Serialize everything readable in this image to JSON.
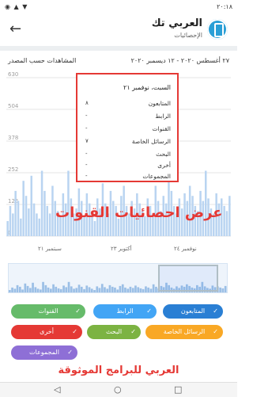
{
  "status": {
    "left": "◉ ▲ ▼",
    "time": "٢٠:١٨"
  },
  "appbar": {
    "back_icon": "arrow-left-icon",
    "title": "العربي تك",
    "subtitle": "الإحصائيات"
  },
  "chart_header": {
    "date_range": "٢٧ أغسطس ٢٠٢٠ - ١٢ ديسمبر ٢٠٢٠",
    "title": "المشاهدات حسب المصدر"
  },
  "chart_data": {
    "type": "bar",
    "y_ticks": [
      "630",
      "504",
      "378",
      "252",
      "126",
      "0"
    ],
    "ylim": [
      0,
      630
    ],
    "x_ticks": [
      "سبتمبر ٢١",
      "أكتوبر ٢٣",
      "نوفمبر ٢٤"
    ],
    "values": [
      60,
      120,
      90,
      180,
      140,
      70,
      220,
      160,
      110,
      240,
      130,
      90,
      70,
      260,
      180,
      120,
      90,
      200,
      140,
      100,
      80,
      170,
      130,
      260,
      150,
      90,
      110,
      190,
      140,
      80,
      170,
      130,
      90,
      60,
      150,
      110,
      210,
      130,
      90,
      180,
      140,
      120,
      70,
      160,
      200,
      120,
      90,
      140,
      110,
      170,
      130,
      100,
      80,
      150,
      120,
      90,
      200,
      140,
      100,
      160,
      130,
      240,
      180,
      120,
      90,
      150,
      110,
      170,
      140,
      200,
      160,
      120,
      100,
      180,
      140,
      260,
      150,
      110,
      90,
      170,
      130,
      150,
      120,
      100,
      160
    ],
    "grid": true
  },
  "tooltip": {
    "date": "السبت، نوفمبر ٢١",
    "rows": [
      {
        "label": "المتابعون",
        "value": "٨"
      },
      {
        "label": "الرابط",
        "value": "-"
      },
      {
        "label": "القنوات",
        "value": "-"
      },
      {
        "label": "الرسائل الخاصة",
        "value": "٧"
      },
      {
        "label": "البحث",
        "value": "-"
      },
      {
        "label": "أخرى",
        "value": "-"
      },
      {
        "label": "المجموعات",
        "value": "-"
      }
    ]
  },
  "overlay": {
    "caption": "عرض احصائيات القنوات"
  },
  "chips": [
    {
      "label": "المتابعون",
      "color": "#2a7fd4"
    },
    {
      "label": "الرابط",
      "color": "#42a5f5"
    },
    {
      "label": "القنوات",
      "color": "#66bb6a"
    },
    {
      "label": "الرسائل الخاصة",
      "color": "#f9a825"
    },
    {
      "label": "البحث",
      "color": "#7cb342"
    },
    {
      "label": "أخرى",
      "color": "#e53935"
    },
    {
      "label": "المجموعات",
      "color": "#8e6fd6"
    }
  ],
  "footer": {
    "caption": "العربي للبرامج الموثوقة"
  },
  "navbar": {
    "icons": [
      "◁",
      "○",
      "□"
    ]
  }
}
